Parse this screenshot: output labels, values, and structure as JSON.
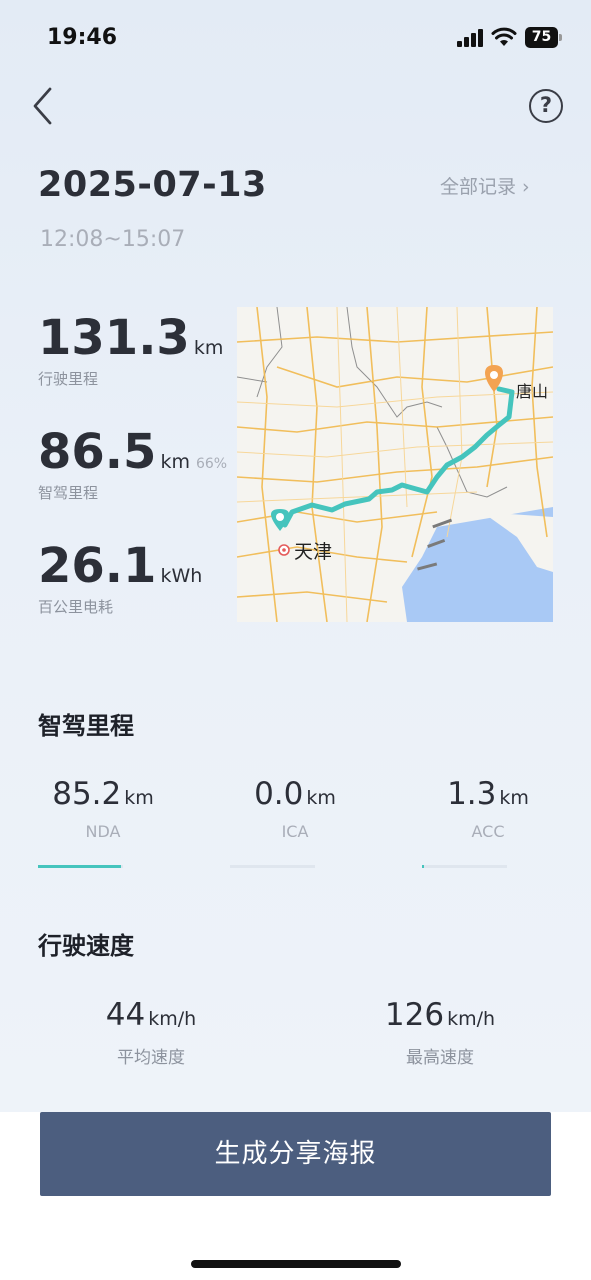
{
  "status_bar": {
    "time": "19:46",
    "battery": "75"
  },
  "header": {
    "date": "2025-07-13",
    "all_records": "全部记录 ›",
    "time_range": "12:08~15:07"
  },
  "stats": [
    {
      "value": "131.3",
      "unit": "km",
      "label": "行驶里程"
    },
    {
      "value": "86.5",
      "unit": "km",
      "percent": "66%",
      "label": "智驾里程"
    },
    {
      "value": "26.1",
      "unit": "kWh",
      "label": "百公里电耗"
    }
  ],
  "map": {
    "origin": "天津",
    "destination": "唐山",
    "route_color": "#45c4bd",
    "origin_color": "#45c4bd",
    "destination_color": "#f3a352"
  },
  "smart_drive": {
    "title": "智驾里程",
    "modes": [
      {
        "value": "85.2",
        "unit": "km",
        "name": "NDA",
        "share": 0.98
      },
      {
        "value": "0.0",
        "unit": "km",
        "name": "ICA",
        "share": 0.0
      },
      {
        "value": "1.3",
        "unit": "km",
        "name": "ACC",
        "share": 0.02
      }
    ]
  },
  "speed": {
    "title": "行驶速度",
    "items": [
      {
        "value": "44",
        "unit": "km/h",
        "name": "平均速度"
      },
      {
        "value": "126",
        "unit": "km/h",
        "name": "最高速度"
      }
    ]
  },
  "share_button": "生成分享海报",
  "colors": {
    "accent": "#45c4bd",
    "button": "#4c5e7f"
  }
}
